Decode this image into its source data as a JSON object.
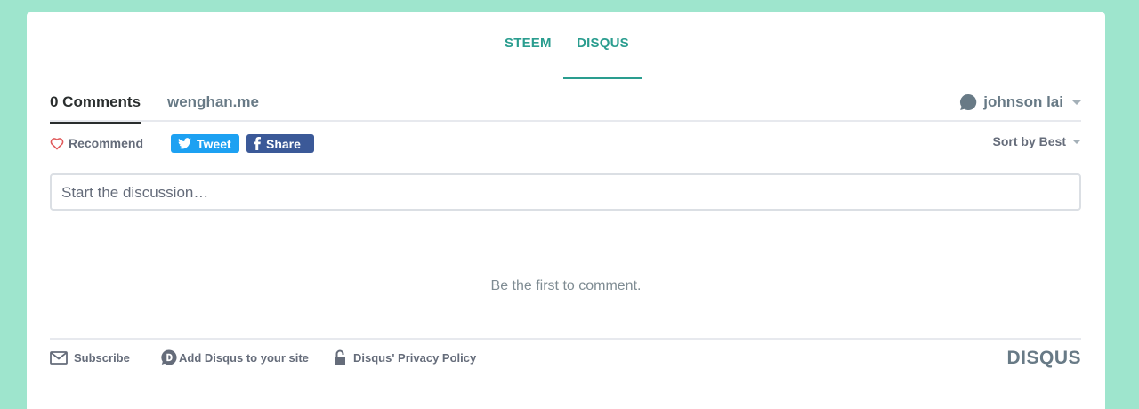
{
  "top_tabs": [
    {
      "label": "STEEM"
    },
    {
      "label": "DISQUS",
      "active": true
    }
  ],
  "nav": {
    "comments_label": "0 Comments",
    "site_label": "wenghan.me",
    "user_name": "johnson lai"
  },
  "actions": {
    "recommend_label": "Recommend",
    "tweet_label": "Tweet",
    "share_label": "Share",
    "sort_label": "Sort by Best"
  },
  "compose": {
    "placeholder": "Start the discussion…"
  },
  "empty_message": "Be the first to comment.",
  "footer": {
    "subscribe_label": "Subscribe",
    "add_label": "Add Disqus to your site",
    "privacy_label": "Disqus' Privacy Policy",
    "logo_text": "DISQUS"
  },
  "colors": {
    "page_background": "#9ee5cd",
    "accent": "#2a9d8f",
    "tweet": "#1da1f2",
    "facebook": "#3b5998",
    "heart": "#e0595a"
  }
}
